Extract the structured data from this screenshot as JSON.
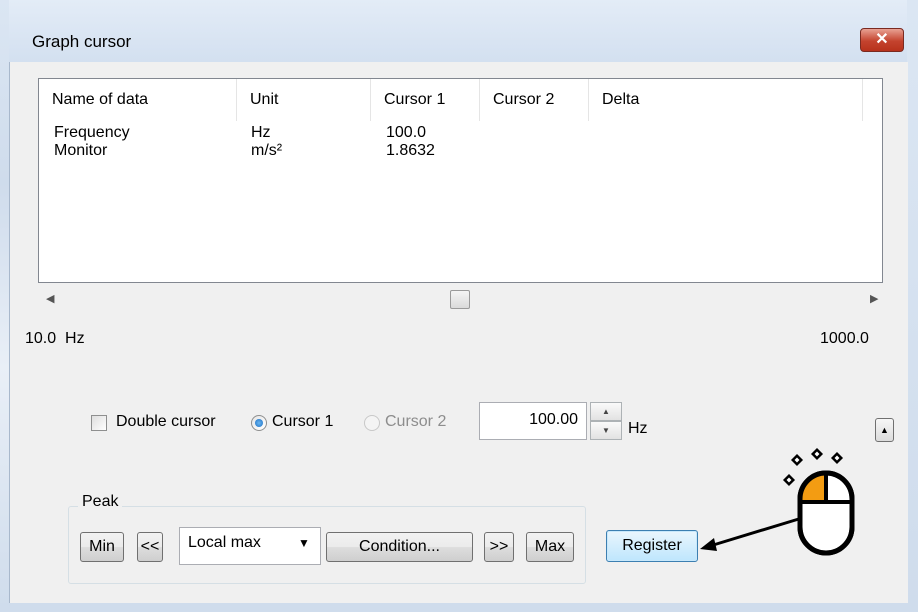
{
  "window": {
    "title": "Graph cursor",
    "close_glyph": "✕"
  },
  "table": {
    "columns": [
      "Name of data",
      "Unit",
      "Cursor 1",
      "Cursor 2",
      "Delta"
    ],
    "rows": [
      {
        "name": "Frequency",
        "unit": "Hz",
        "cursor1": "100.0",
        "cursor2": "",
        "delta": ""
      },
      {
        "name": "Monitor",
        "unit": "m/s²",
        "cursor1": "1.8632",
        "cursor2": "",
        "delta": ""
      }
    ]
  },
  "scroll": {
    "position_fraction": 0.5
  },
  "range": {
    "min_label": "10.0  Hz",
    "max_label": "1000.0"
  },
  "cursor_options": {
    "double_cursor_label": "Double cursor",
    "double_cursor_checked": false,
    "cursor1_label": "Cursor 1",
    "cursor2_label": "Cursor 2",
    "selected": "Cursor 1",
    "value": "100.00",
    "unit": "Hz"
  },
  "peak": {
    "group_label": "Peak",
    "min_label": "Min",
    "prev_label": "<<",
    "mode_value": "Local max",
    "condition_label": "Condition...",
    "next_label": ">>",
    "max_label": "Max"
  },
  "register_label": "Register",
  "colors": {
    "accent": "#f39c12",
    "close_red": "#c4432e",
    "window_frame": "#d3e0f0"
  }
}
